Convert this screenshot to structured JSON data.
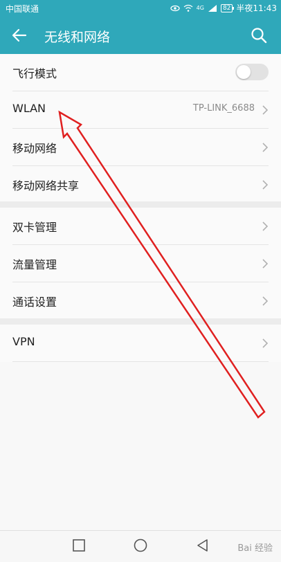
{
  "status_bar": {
    "carrier": "中国联通",
    "network_label": "4G",
    "battery": "82",
    "time": "半夜11:43"
  },
  "app_bar": {
    "title": "无线和网络",
    "back_icon": "arrow-left-icon",
    "search_icon": "search-icon"
  },
  "groups": [
    {
      "items": [
        {
          "label": "飞行模式",
          "type": "toggle",
          "checked": false
        },
        {
          "label": "WLAN",
          "value": "TP-LINK_6688"
        },
        {
          "label": "移动网络"
        },
        {
          "label": "移动网络共享"
        }
      ]
    },
    {
      "items": [
        {
          "label": "双卡管理"
        },
        {
          "label": "流量管理"
        },
        {
          "label": "通话设置"
        }
      ]
    },
    {
      "items": [
        {
          "label": "VPN"
        }
      ]
    }
  ],
  "nav_bar": {
    "recent_icon": "square-icon",
    "home_icon": "circle-icon",
    "back_icon": "triangle-back-icon"
  },
  "watermark": "Bai 经验",
  "colors": {
    "accent": "#2fa8ba",
    "annotation_arrow": "#e02020"
  }
}
